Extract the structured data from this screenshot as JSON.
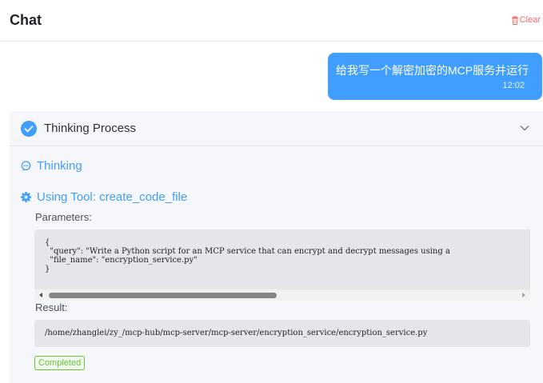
{
  "header": {
    "title": "Chat",
    "clear_label": "Clear"
  },
  "message": {
    "text": "给我写一个解密加密的MCP服务并运行",
    "time": "12:02"
  },
  "thinking_panel": {
    "title": "Thinking Process",
    "steps": {
      "thinking_label": "Thinking",
      "tool_label": "Using Tool: create_code_file"
    },
    "parameters_label": "Parameters:",
    "parameters_code": "{\n  \"query\": \"Write a Python script for an MCP service that can encrypt and decrypt messages using a\n  \"file_name\": \"encryption_service.py\"\n}",
    "result_label": "Result:",
    "result_text": "/home/zhanglei/zy_/mcp-hub/mcp-server/mcp-server/encryption_service/encryption_service.py",
    "status": "Completed"
  },
  "colors": {
    "accent": "#409eff",
    "danger": "#f56c6c",
    "success": "#67c23a"
  },
  "icons": {
    "clear": "trash-icon",
    "panel_status": "check-circle-icon",
    "collapse": "chevron-down-icon",
    "thinking": "chat-bubble-icon",
    "tool": "gear-icon"
  }
}
